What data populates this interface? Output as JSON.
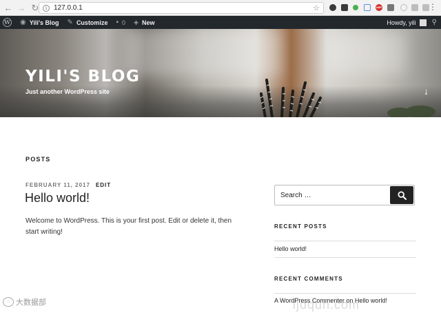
{
  "browser": {
    "url": "127.0.0.1",
    "extension_colors": [
      "#3a3a3a",
      "#3a3a3a",
      "#4caf50",
      "#8ab4f8",
      "#d32f2f",
      "#777777",
      "#bdbdbd",
      "#bdbdbd",
      "#bdbdbd"
    ],
    "ext_abp_label": "ABP"
  },
  "adminbar": {
    "site_name": "Yili's Blog",
    "customize": "Customize",
    "comments_count": "0",
    "new_label": "New",
    "howdy": "Howdy, yili"
  },
  "header": {
    "site_title": "YILI'S BLOG",
    "site_description": "Just another WordPress site"
  },
  "main": {
    "section_heading": "POSTS",
    "post": {
      "date": "FEBRUARY 11, 2017",
      "edit_label": "EDIT",
      "title": "Hello world!",
      "excerpt": "Welcome to WordPress. This is your first post. Edit or delete it, then start writing!"
    }
  },
  "sidebar": {
    "search_placeholder": "Search …",
    "recent_posts_title": "RECENT POSTS",
    "recent_posts": [
      "Hello world!"
    ],
    "recent_comments_title": "RECENT COMMENTS",
    "recent_comment": {
      "author": "A WordPress Commenter",
      "on": "on",
      "post": "Hello world!"
    }
  },
  "watermarks": {
    "left": "大数据部",
    "right": "ljdqun.com"
  },
  "colors": {
    "adminbar_bg": "#23282d",
    "search_button_bg": "#222222"
  }
}
